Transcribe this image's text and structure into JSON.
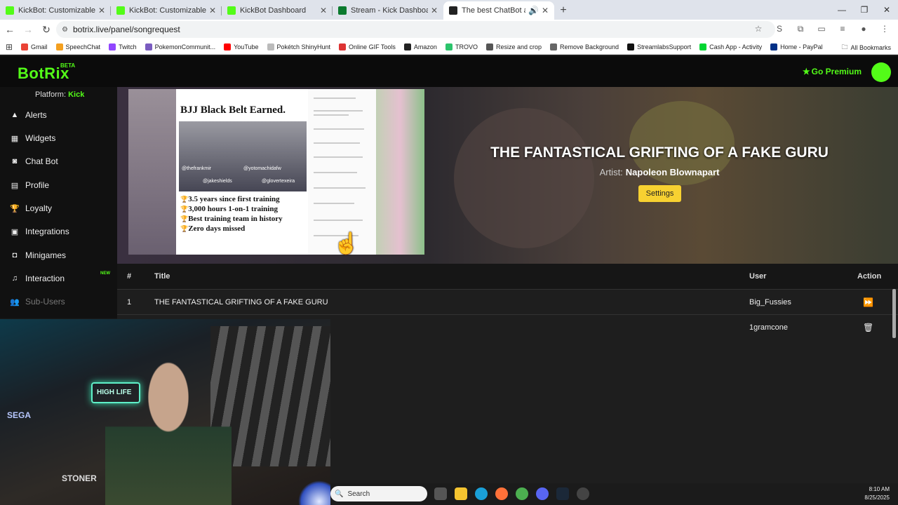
{
  "browser": {
    "tabs": [
      {
        "label": "KickBot: Customizable Chat Bo",
        "color": "#53fc18"
      },
      {
        "label": "KickBot: Customizable Chat Bo",
        "color": "#53fc18"
      },
      {
        "label": "KickBot Dashboard",
        "color": "#53fc18"
      },
      {
        "label": "Stream - Kick Dashboard",
        "color": "#0b7a2e"
      },
      {
        "label": "The best ChatBot and Widg",
        "color": "#222222"
      }
    ],
    "url": "botrix.live/panel/songrequest",
    "bookmarks": [
      "Gmail",
      "SpeechChat",
      "Twitch",
      "PokemonCommunit...",
      "YouTube",
      "Pokétch ShinyHunt",
      "Online GIF Tools",
      "Amazon",
      "TROVO",
      "Resize and crop",
      "Remove Background",
      "StreamlabsSupport",
      "Cash App - Activity",
      "Home - PayPal"
    ],
    "all_bookmarks": "All Bookmarks"
  },
  "app": {
    "logo": "BotRix",
    "logo_badge": "BETA",
    "premium": "Go Premium",
    "platform_label": "Platform:",
    "platform_value": "Kick",
    "accent": "#53fc18"
  },
  "sidebar": {
    "items": [
      {
        "label": "Alerts",
        "icon": "warning-icon"
      },
      {
        "label": "Widgets",
        "icon": "grid-icon"
      },
      {
        "label": "Chat Bot",
        "icon": "robot-icon"
      },
      {
        "label": "Profile",
        "icon": "id-card-icon"
      },
      {
        "label": "Loyalty",
        "icon": "trophy-icon"
      },
      {
        "label": "Integrations",
        "icon": "plug-icon"
      },
      {
        "label": "Minigames",
        "icon": "gamepad-icon"
      },
      {
        "label": "Interaction",
        "icon": "music-icon",
        "badge": "NEW"
      },
      {
        "label": "Sub-Users",
        "icon": "users-icon"
      }
    ]
  },
  "now_playing": {
    "title": "THE FANTASTICAL GRIFTING OF A FAKE GURU",
    "artist_label": "Artist:",
    "artist": "Napoleon Blownapart",
    "settings_label": "Settings",
    "thumbnail": {
      "heading": "BJJ Black Belt Earned.",
      "lines": [
        "3.5 years since first training",
        "3,000 hours 1-on-1 training",
        "Best training team in history",
        "Zero days missed"
      ],
      "tags": [
        "@thefrankmir",
        "@yotomachidafw",
        "@jakeshields",
        "@glovertexeira"
      ]
    }
  },
  "queue": {
    "headers": {
      "num": "#",
      "title": "Title",
      "user": "User",
      "action": "Action"
    },
    "rows": [
      {
        "num": "1",
        "title": "THE FANTASTICAL GRIFTING OF A FAKE GURU",
        "user": "Big_Fussies",
        "action_icon": "skip-forward-icon"
      },
      {
        "num": "",
        "title": "",
        "user": "1gramcone",
        "action_icon": "trash-icon"
      }
    ]
  },
  "webcam": {
    "neon_sign": "HIGH LIFE",
    "sega": "SEGA",
    "stoner": "STONER"
  },
  "taskbar": {
    "search_placeholder": "Search",
    "time": "8:10 AM",
    "date": "8/25/2025"
  }
}
